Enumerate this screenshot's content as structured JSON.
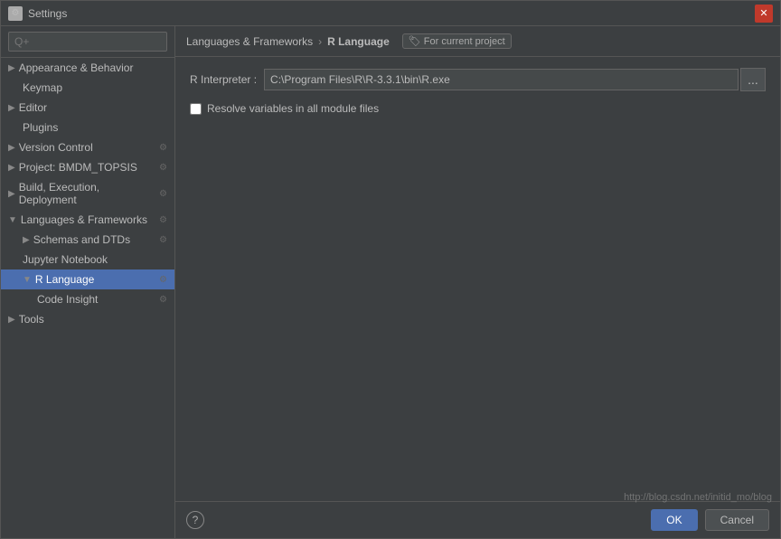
{
  "window": {
    "title": "Settings"
  },
  "search": {
    "placeholder": "Q+",
    "value": ""
  },
  "sidebar": {
    "items": [
      {
        "id": "appearance",
        "label": "Appearance & Behavior",
        "level": 1,
        "has_arrow": true,
        "arrow_dir": "right",
        "selected": false
      },
      {
        "id": "keymap",
        "label": "Keymap",
        "level": 2,
        "selected": false
      },
      {
        "id": "editor",
        "label": "Editor",
        "level": 1,
        "has_arrow": true,
        "arrow_dir": "right",
        "selected": false
      },
      {
        "id": "plugins",
        "label": "Plugins",
        "level": 2,
        "selected": false
      },
      {
        "id": "version-control",
        "label": "Version Control",
        "level": 1,
        "has_arrow": true,
        "arrow_dir": "right",
        "selected": false,
        "has_settings": true
      },
      {
        "id": "project",
        "label": "Project: BMDM_TOPSIS",
        "level": 1,
        "has_arrow": true,
        "arrow_dir": "right",
        "selected": false,
        "has_settings": true
      },
      {
        "id": "build-execution",
        "label": "Build, Execution, Deployment",
        "level": 1,
        "has_arrow": true,
        "arrow_dir": "right",
        "selected": false,
        "has_settings": true
      },
      {
        "id": "languages-frameworks",
        "label": "Languages & Frameworks",
        "level": 1,
        "has_arrow": true,
        "arrow_dir": "down",
        "selected": false,
        "has_settings": true
      },
      {
        "id": "schemas-dtds",
        "label": "Schemas and DTDs",
        "level": 2,
        "has_arrow": true,
        "arrow_dir": "right",
        "selected": false,
        "has_settings": true
      },
      {
        "id": "jupyter",
        "label": "Jupyter Notebook",
        "level": 2,
        "selected": false
      },
      {
        "id": "r-language",
        "label": "R Language",
        "level": 2,
        "selected": true,
        "has_settings": true
      },
      {
        "id": "code-insight",
        "label": "Code Insight",
        "level": 3,
        "selected": false,
        "has_settings": true
      },
      {
        "id": "tools",
        "label": "Tools",
        "level": 1,
        "has_arrow": true,
        "arrow_dir": "right",
        "selected": false
      }
    ]
  },
  "breadcrumb": {
    "items": [
      "Languages & Frameworks",
      "R Language"
    ],
    "separator": "›",
    "tag": "For current project"
  },
  "panel": {
    "interpreter_label": "R Interpreter :",
    "interpreter_value": "C:\\Program Files\\R\\R-3.3.1\\bin\\R.exe",
    "interpreter_btn": "...",
    "checkbox_label": "Resolve variables in all module files",
    "checkbox_checked": false
  },
  "footer": {
    "ok_label": "OK",
    "cancel_label": "Cancel",
    "help_label": "?"
  },
  "watermark": "http://blog.csdn.net/initid_mo/blog"
}
